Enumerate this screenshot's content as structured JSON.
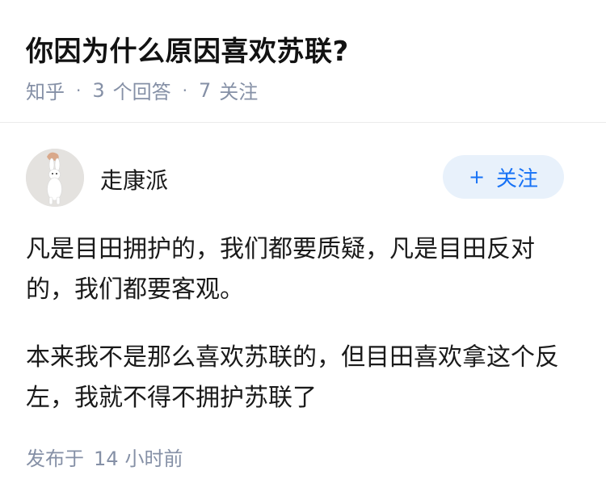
{
  "question": {
    "title": "你因为什么原因喜欢苏联?",
    "source": "知乎",
    "answer_count": "3",
    "answer_label": "个回答",
    "follower_count": "7",
    "follower_label": "关注"
  },
  "answer": {
    "author_name": "走康派",
    "follow_button": {
      "plus": "+",
      "label": "关注"
    },
    "paragraphs": [
      "凡是目田拥护的，我们都要质疑，凡是目田反对的，我们都要客观。",
      "本来我不是那么喜欢苏联的，但目田喜欢拿这个反左，我就不得不拥护苏联了"
    ],
    "posted_prefix": "发布于",
    "posted_num": "14",
    "posted_suffix": "小时前"
  },
  "colors": {
    "accent": "#1772f6",
    "meta_gray": "#8590a6",
    "follow_bg": "#e8f1fb"
  },
  "icons": {
    "avatar": "rabbit-photo-avatar"
  }
}
